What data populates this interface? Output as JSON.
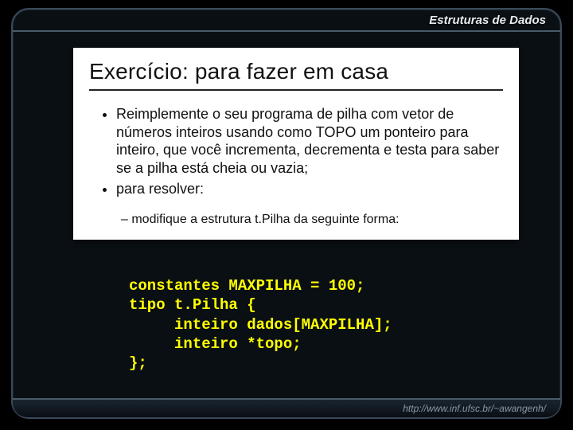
{
  "header": {
    "title": "Estruturas de Dados"
  },
  "footer": {
    "url": "http://www.inf.ufsc.br/~awangenh/"
  },
  "slide": {
    "title": "Exercício: para fazer em casa",
    "bullets": [
      "Reimplemente o seu programa de pilha com vetor de números inteiros usando como TOPO um ponteiro para inteiro, que você incrementa, decrementa e testa para saber se a pilha está cheia ou vazia;",
      "para resolver:"
    ],
    "subbullet": "modifique a estrutura t.Pilha da seguinte forma:",
    "code": "constantes MAXPILHA = 100;\ntipo t.Pilha {\n     inteiro dados[MAXPILHA];\n     inteiro *topo;\n};"
  }
}
